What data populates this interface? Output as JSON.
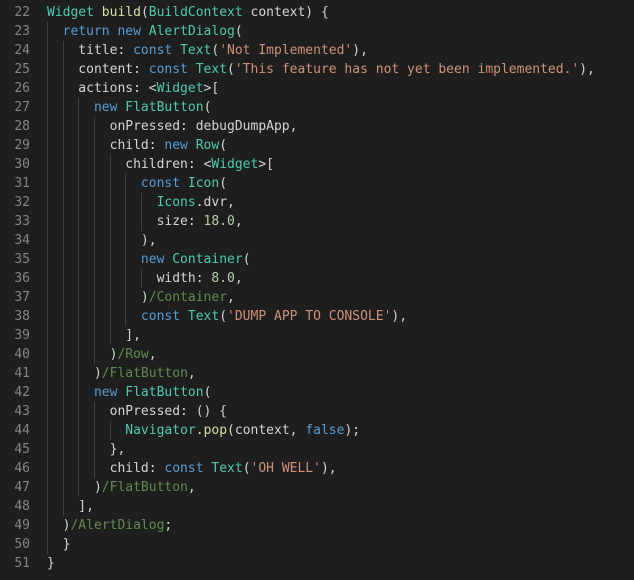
{
  "colors": {
    "background": "#1e1e1e",
    "line_number": "#858585",
    "indent_guide": "#404040",
    "keyword": "#569cd6",
    "type": "#4ec9b0",
    "function": "#dcdcaa",
    "string": "#ce9178",
    "number": "#b5cea8",
    "variable": "#9cdcfe",
    "comment": "#608b4e",
    "plain": "#d4d4d4"
  },
  "lines": [
    {
      "num": "22",
      "tokens": [
        [
          "type",
          "Widget"
        ],
        [
          "pl",
          " "
        ],
        [
          "fn",
          "build"
        ],
        [
          "pl",
          "("
        ],
        [
          "type",
          "BuildContext"
        ],
        [
          "pl",
          " context) {"
        ]
      ]
    },
    {
      "num": "23",
      "tokens": [
        [
          "pl",
          "  "
        ],
        [
          "kw",
          "return"
        ],
        [
          "pl",
          " "
        ],
        [
          "kw",
          "new"
        ],
        [
          "pl",
          " "
        ],
        [
          "type",
          "AlertDialog"
        ],
        [
          "pl",
          "("
        ]
      ]
    },
    {
      "num": "24",
      "tokens": [
        [
          "pl",
          "    title: "
        ],
        [
          "kw",
          "const"
        ],
        [
          "pl",
          " "
        ],
        [
          "type",
          "Text"
        ],
        [
          "pl",
          "("
        ],
        [
          "str",
          "'Not Implemented'"
        ],
        [
          "pl",
          "),"
        ]
      ]
    },
    {
      "num": "25",
      "tokens": [
        [
          "pl",
          "    content: "
        ],
        [
          "kw",
          "const"
        ],
        [
          "pl",
          " "
        ],
        [
          "type",
          "Text"
        ],
        [
          "pl",
          "("
        ],
        [
          "str",
          "'This feature has not yet been implemented.'"
        ],
        [
          "pl",
          "),"
        ]
      ]
    },
    {
      "num": "26",
      "tokens": [
        [
          "pl",
          "    actions: <"
        ],
        [
          "type",
          "Widget"
        ],
        [
          "pl",
          ">["
        ]
      ]
    },
    {
      "num": "27",
      "tokens": [
        [
          "pl",
          "      "
        ],
        [
          "kw",
          "new"
        ],
        [
          "pl",
          " "
        ],
        [
          "type",
          "FlatButton"
        ],
        [
          "pl",
          "("
        ]
      ]
    },
    {
      "num": "28",
      "tokens": [
        [
          "pl",
          "        onPressed: debugDumpApp,"
        ]
      ]
    },
    {
      "num": "29",
      "tokens": [
        [
          "pl",
          "        child: "
        ],
        [
          "kw",
          "new"
        ],
        [
          "pl",
          " "
        ],
        [
          "type",
          "Row"
        ],
        [
          "pl",
          "("
        ]
      ]
    },
    {
      "num": "30",
      "tokens": [
        [
          "pl",
          "          children: <"
        ],
        [
          "type",
          "Widget"
        ],
        [
          "pl",
          ">["
        ]
      ]
    },
    {
      "num": "31",
      "tokens": [
        [
          "pl",
          "            "
        ],
        [
          "kw",
          "const"
        ],
        [
          "pl",
          " "
        ],
        [
          "type",
          "Icon"
        ],
        [
          "pl",
          "("
        ]
      ]
    },
    {
      "num": "32",
      "tokens": [
        [
          "pl",
          "              "
        ],
        [
          "type",
          "Icons"
        ],
        [
          "pl",
          ".dvr,"
        ]
      ]
    },
    {
      "num": "33",
      "tokens": [
        [
          "pl",
          "              size: "
        ],
        [
          "num",
          "18.0"
        ],
        [
          "pl",
          ","
        ]
      ]
    },
    {
      "num": "34",
      "tokens": [
        [
          "pl",
          "            ),"
        ]
      ]
    },
    {
      "num": "35",
      "tokens": [
        [
          "pl",
          "            "
        ],
        [
          "kw",
          "new"
        ],
        [
          "pl",
          " "
        ],
        [
          "type",
          "Container"
        ],
        [
          "pl",
          "("
        ]
      ]
    },
    {
      "num": "36",
      "tokens": [
        [
          "pl",
          "              width: "
        ],
        [
          "num",
          "8.0"
        ],
        [
          "pl",
          ","
        ]
      ]
    },
    {
      "num": "37",
      "tokens": [
        [
          "pl",
          "            )"
        ],
        [
          "cm",
          "/Container"
        ],
        [
          "pl",
          ","
        ]
      ]
    },
    {
      "num": "38",
      "tokens": [
        [
          "pl",
          "            "
        ],
        [
          "kw",
          "const"
        ],
        [
          "pl",
          " "
        ],
        [
          "type",
          "Text"
        ],
        [
          "pl",
          "("
        ],
        [
          "str",
          "'DUMP APP TO CONSOLE'"
        ],
        [
          "pl",
          "),"
        ]
      ]
    },
    {
      "num": "39",
      "tokens": [
        [
          "pl",
          "          ],"
        ]
      ]
    },
    {
      "num": "40",
      "tokens": [
        [
          "pl",
          "        )"
        ],
        [
          "cm",
          "/Row"
        ],
        [
          "pl",
          ","
        ]
      ]
    },
    {
      "num": "41",
      "tokens": [
        [
          "pl",
          "      )"
        ],
        [
          "cm",
          "/FlatButton"
        ],
        [
          "pl",
          ","
        ]
      ]
    },
    {
      "num": "42",
      "tokens": [
        [
          "pl",
          "      "
        ],
        [
          "kw",
          "new"
        ],
        [
          "pl",
          " "
        ],
        [
          "type",
          "FlatButton"
        ],
        [
          "pl",
          "("
        ]
      ]
    },
    {
      "num": "43",
      "tokens": [
        [
          "pl",
          "        onPressed: () {"
        ]
      ]
    },
    {
      "num": "44",
      "tokens": [
        [
          "pl",
          "          "
        ],
        [
          "type",
          "Navigator"
        ],
        [
          "pl",
          "."
        ],
        [
          "fn",
          "pop"
        ],
        [
          "pl",
          "(context, "
        ],
        [
          "kw",
          "false"
        ],
        [
          "pl",
          ");"
        ]
      ]
    },
    {
      "num": "45",
      "tokens": [
        [
          "pl",
          "        },"
        ]
      ]
    },
    {
      "num": "46",
      "tokens": [
        [
          "pl",
          "        child: "
        ],
        [
          "kw",
          "const"
        ],
        [
          "pl",
          " "
        ],
        [
          "type",
          "Text"
        ],
        [
          "pl",
          "("
        ],
        [
          "str",
          "'OH WELL'"
        ],
        [
          "pl",
          "),"
        ]
      ]
    },
    {
      "num": "47",
      "tokens": [
        [
          "pl",
          "      )"
        ],
        [
          "cm",
          "/FlatButton"
        ],
        [
          "pl",
          ","
        ]
      ]
    },
    {
      "num": "48",
      "tokens": [
        [
          "pl",
          "    ],"
        ]
      ]
    },
    {
      "num": "49",
      "tokens": [
        [
          "pl",
          "  )"
        ],
        [
          "cm",
          "/AlertDialog"
        ],
        [
          "pl",
          ";"
        ]
      ]
    },
    {
      "num": "50",
      "tokens": [
        [
          "pl",
          "  }"
        ]
      ]
    },
    {
      "num": "51",
      "tokens": [
        [
          "pl",
          "}"
        ]
      ]
    }
  ]
}
